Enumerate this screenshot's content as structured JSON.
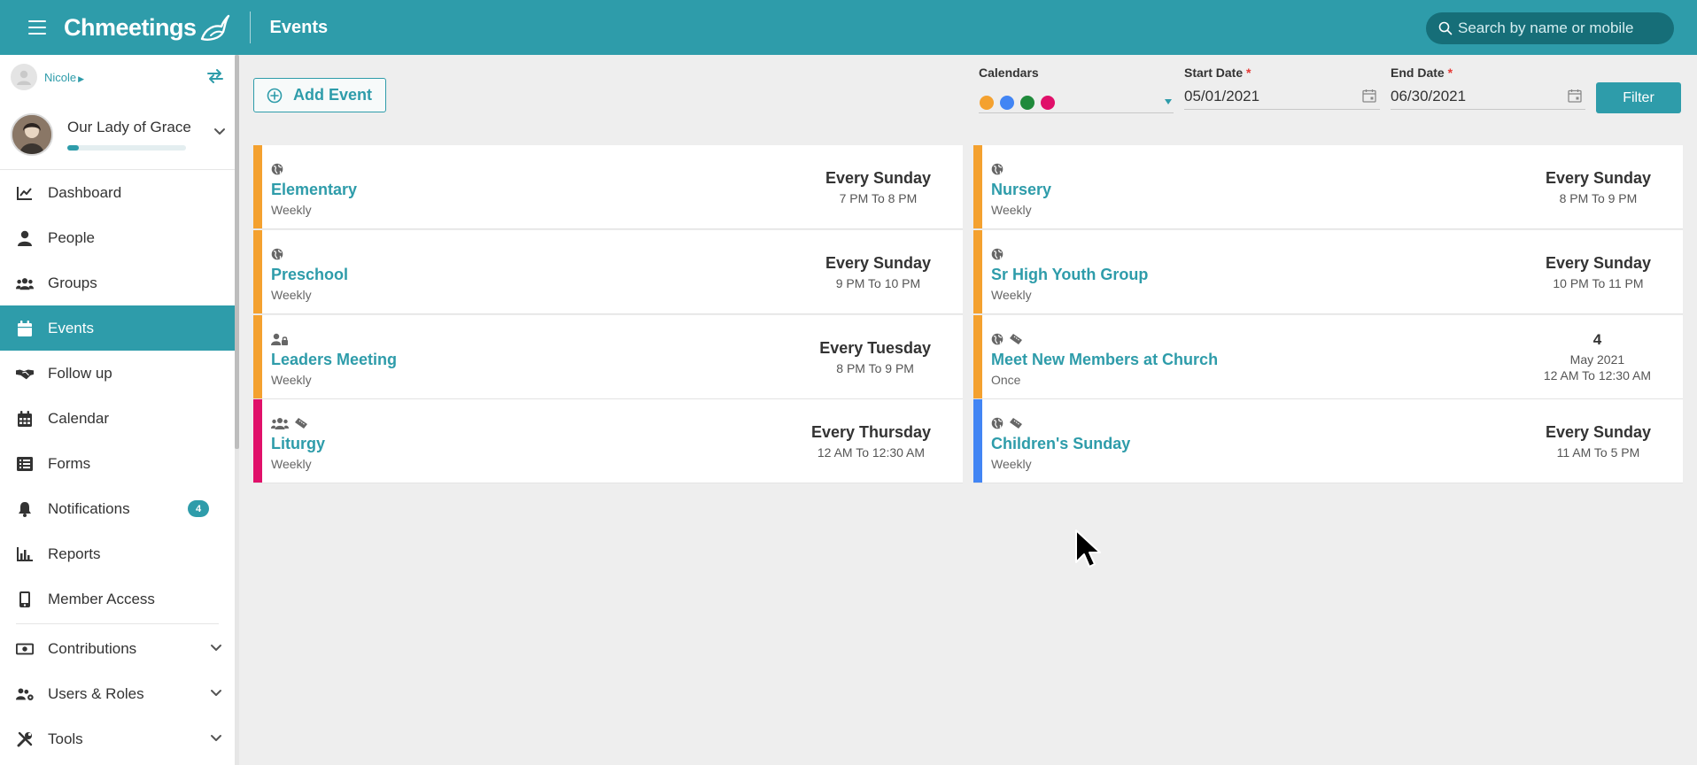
{
  "app": {
    "brand": "Chmeetings",
    "page_title": "Events"
  },
  "search": {
    "placeholder": "Search by name or mobile"
  },
  "user": {
    "name": "Nicole"
  },
  "org": {
    "name": "Our Lady of Grace",
    "setup_progress": 0.1
  },
  "nav": [
    {
      "id": "dashboard",
      "label": "Dashboard",
      "icon": "chart-line-icon"
    },
    {
      "id": "people",
      "label": "People",
      "icon": "person-icon"
    },
    {
      "id": "groups",
      "label": "Groups",
      "icon": "users-group-icon"
    },
    {
      "id": "events",
      "label": "Events",
      "icon": "calendar-icon",
      "active": true
    },
    {
      "id": "follow-up",
      "label": "Follow up",
      "icon": "handshake-icon"
    },
    {
      "id": "calendar",
      "label": "Calendar",
      "icon": "calendar-grid-icon"
    },
    {
      "id": "forms",
      "label": "Forms",
      "icon": "list-form-icon"
    },
    {
      "id": "notifications",
      "label": "Notifications",
      "icon": "bell-icon",
      "badge": "4"
    },
    {
      "id": "reports",
      "label": "Reports",
      "icon": "bar-chart-icon"
    },
    {
      "id": "member-access",
      "label": "Member Access",
      "icon": "mobile-icon"
    },
    {
      "id": "contributions",
      "label": "Contributions",
      "icon": "money-icon",
      "expandable": true
    },
    {
      "id": "users-roles",
      "label": "Users & Roles",
      "icon": "users-cog-icon",
      "expandable": true
    },
    {
      "id": "tools",
      "label": "Tools",
      "icon": "tools-icon",
      "expandable": true
    }
  ],
  "toolbar": {
    "add_event_label": "Add Event",
    "calendars_label": "Calendars",
    "calendar_colors": [
      "#f4a12f",
      "#4285f4",
      "#1f8a3b",
      "#e0106a"
    ],
    "start_date_label": "Start Date",
    "start_date_value": "05/01/2021",
    "end_date_label": "End Date",
    "end_date_value": "06/30/2021",
    "required_marker": "*",
    "filter_label": "Filter"
  },
  "events_left": [
    {
      "name": "Elementary",
      "frequency": "Weekly",
      "day": "Every Sunday",
      "time": "7 PM To 8 PM",
      "color": "#f4a12f",
      "icons": [
        "globe-icon"
      ]
    },
    {
      "name": "Preschool",
      "frequency": "Weekly",
      "day": "Every Sunday",
      "time": "9 PM To 10 PM",
      "color": "#f4a12f",
      "icons": [
        "globe-icon"
      ]
    },
    {
      "name": "Leaders Meeting",
      "frequency": "Weekly",
      "day": "Every Tuesday",
      "time": "8 PM To 9 PM",
      "color": "#f4a12f",
      "icons": [
        "user-lock-icon"
      ]
    },
    {
      "name": "Liturgy",
      "frequency": "Weekly",
      "day": "Every Thursday",
      "time": "12 AM To 12:30 AM",
      "color": "#e0106a",
      "icons": [
        "users-group-icon",
        "ticket-icon"
      ]
    }
  ],
  "events_right": [
    {
      "name": "Nursery",
      "frequency": "Weekly",
      "day": "Every Sunday",
      "time": "8 PM To 9 PM",
      "color": "#f4a12f",
      "icons": [
        "globe-icon"
      ]
    },
    {
      "name": "Sr High Youth Group",
      "frequency": "Weekly",
      "day": "Every Sunday",
      "time": "10 PM To 11 PM",
      "color": "#f4a12f",
      "icons": [
        "globe-icon"
      ]
    },
    {
      "name": "Meet New Members at Church",
      "frequency": "Once",
      "day": "4",
      "month": "May 2021",
      "time": "12 AM To 12:30 AM",
      "color": "#f4a12f",
      "icons": [
        "globe-icon",
        "ticket-icon"
      ]
    },
    {
      "name": "Children's Sunday",
      "frequency": "Weekly",
      "day": "Every Sunday",
      "time": "11 AM To 5 PM",
      "color": "#4285f4",
      "icons": [
        "globe-icon",
        "ticket-icon"
      ]
    }
  ]
}
